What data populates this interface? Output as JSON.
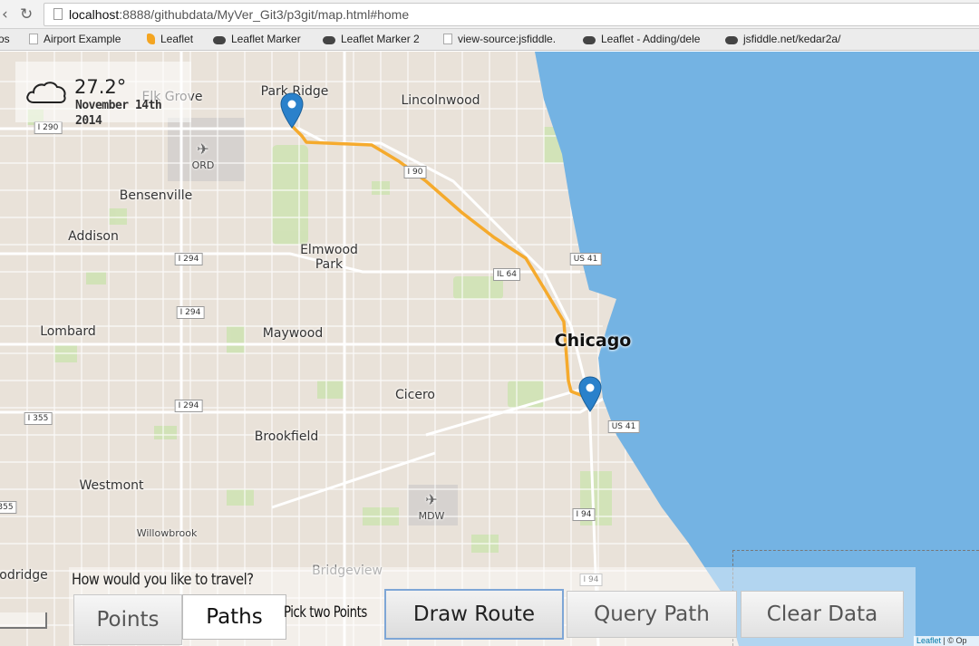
{
  "browser": {
    "url_host": "localhost",
    "url_rest": ":8888/githubdata/MyVer_Git3/p3git/map.html#home",
    "bookmarks": [
      {
        "label": "os",
        "icon": "none"
      },
      {
        "label": "Airport Example",
        "icon": "page-icon"
      },
      {
        "label": "Leaflet",
        "icon": "leaflet-icon"
      },
      {
        "label": "Leaflet Marker",
        "icon": "github-icon"
      },
      {
        "label": "Leaflet Marker 2",
        "icon": "github-icon"
      },
      {
        "label": "view-source:jsfiddle.",
        "icon": "page-icon"
      },
      {
        "label": "Leaflet - Adding/dele",
        "icon": "github-icon"
      },
      {
        "label": "jsfiddle.net/kedar2a/",
        "icon": "github-icon"
      }
    ]
  },
  "weather": {
    "temperature": "27.2°",
    "date_line1": "November 14th",
    "date_line2": "2014",
    "icon": "cloud-icon"
  },
  "map": {
    "places": [
      "Park Ridge",
      "Lincolnwood",
      "Elk Grove",
      "ORD",
      "Bensenville",
      "Addison",
      "Elmwood Park",
      "Lombard",
      "Maywood",
      "Chicago",
      "Cicero",
      "Brookfield",
      "Westmont",
      "Willowbrook",
      "MDW",
      "Bridgeview",
      "odridge"
    ],
    "shields": [
      "I 290",
      "I 90",
      "I 294",
      "IL 64",
      "US 41",
      "I 355",
      "I 94",
      "355"
    ],
    "route_color": "#f5a623",
    "marker_color": "#2a81cb",
    "water_color": "#74b3e3",
    "land_color": "#e8e0d8",
    "attribution_link": "Leaflet",
    "attribution_rest": " | © Op"
  },
  "panel": {
    "question": "How would you like to travel?",
    "points_label": "Points",
    "paths_label": "Paths",
    "pick_label": "Pick two Points",
    "draw_route_label": "Draw Route",
    "query_path_label": "Query Path",
    "clear_data_label": "Clear Data"
  }
}
